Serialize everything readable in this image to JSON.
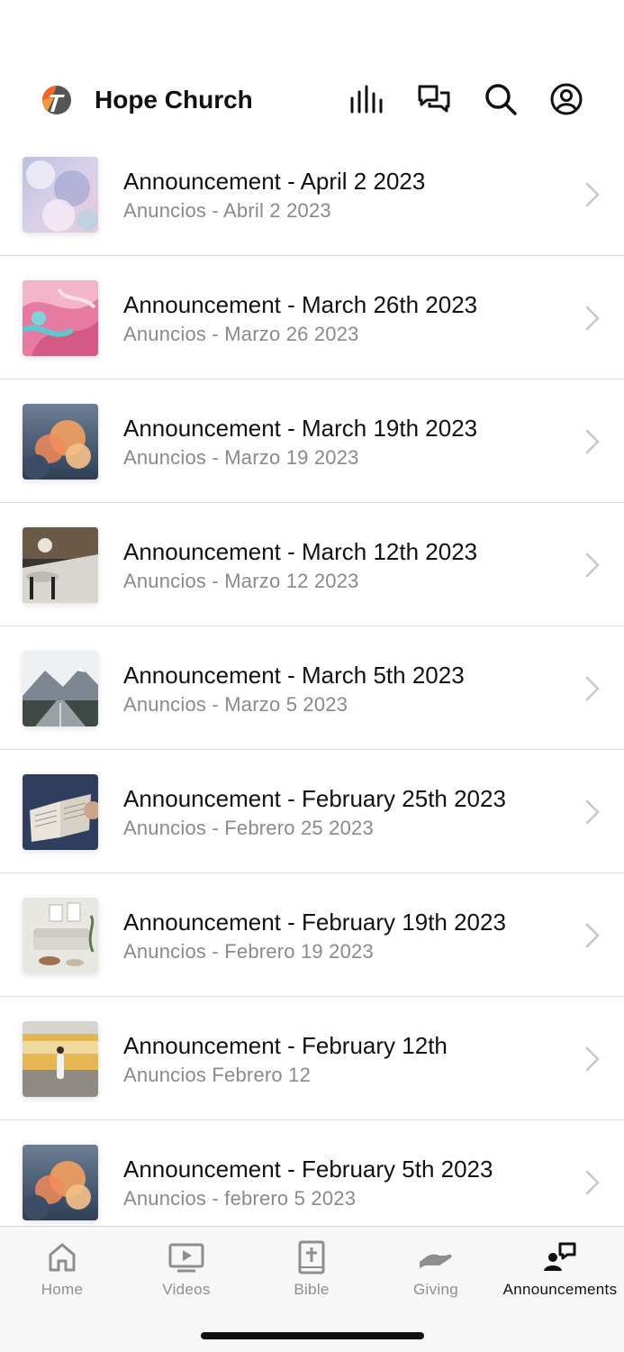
{
  "header": {
    "app_title": "Hope Church",
    "icons": [
      "logo-icon",
      "live-audio-icon",
      "chat-icon",
      "search-icon",
      "profile-icon"
    ]
  },
  "announcements": [
    {
      "title": "Announcement - April 2 2023",
      "subtitle": "Anuncios - Abril 2 2023",
      "thumb": "clouds-pastel"
    },
    {
      "title": "Announcement - March 26th 2023",
      "subtitle": "Anuncios - Marzo 26 2023",
      "thumb": "pink-marble"
    },
    {
      "title": "Announcement - March 19th 2023",
      "subtitle": "Anuncios - Marzo 19 2023",
      "thumb": "sunset-clouds"
    },
    {
      "title": "Announcement - March 12th 2023",
      "subtitle": "Anuncios - Marzo 12 2023",
      "thumb": "living-room-rug"
    },
    {
      "title": "Announcement - March 5th 2023",
      "subtitle": "Anuncios - Marzo 5 2023",
      "thumb": "mountain-road"
    },
    {
      "title": "Announcement - February 25th 2023",
      "subtitle": "Anuncios - Febrero 25 2023",
      "thumb": "open-bible"
    },
    {
      "title": "Announcement - February 19th 2023",
      "subtitle": "Anuncios - Febrero 19 2023",
      "thumb": "sofa-room"
    },
    {
      "title": "Announcement - February 12th",
      "subtitle": "Anuncios Febrero 12",
      "thumb": "train-station"
    },
    {
      "title": "Announcement - February 5th 2023",
      "subtitle": "Anuncios - febrero 5 2023",
      "thumb": "sunset-clouds"
    }
  ],
  "tabs": [
    {
      "label": "Home",
      "icon": "home-icon",
      "active": false
    },
    {
      "label": "Videos",
      "icon": "video-icon",
      "active": false
    },
    {
      "label": "Bible",
      "icon": "bible-icon",
      "active": false
    },
    {
      "label": "Giving",
      "icon": "giving-hand-icon",
      "active": false
    },
    {
      "label": "Announcements",
      "icon": "announcements-icon",
      "active": true
    }
  ],
  "colors": {
    "logo_orange": "#f0692a",
    "logo_gray": "#555555",
    "active_tab": "#111111",
    "inactive_tab": "#8e8e8e",
    "subtitle": "#8a8a8a"
  }
}
